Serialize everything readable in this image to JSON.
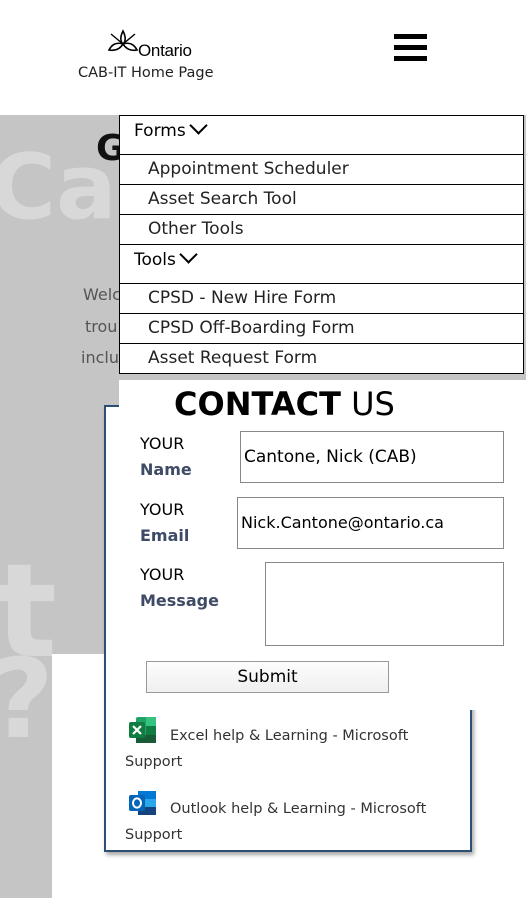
{
  "header": {
    "logo_text": "Ontario",
    "home_link": "CAB-IT Home Page",
    "menu_icon": "hamburger-menu-icon"
  },
  "background": {
    "title_fragment": "G",
    "para_lines": [
      "Welc",
      "trou",
      "inclu"
    ]
  },
  "menu": {
    "sections": [
      {
        "label": "Forms",
        "items": [
          "Appointment Scheduler",
          "Asset Search Tool",
          "Other Tools"
        ]
      },
      {
        "label": "Tools",
        "items": [
          "CPSD - New Hire Form",
          "CPSD Off-Boarding Form",
          "Asset Request Form"
        ]
      }
    ]
  },
  "contact": {
    "title_bold": "CONTACT",
    "title_rest": "US",
    "fields": {
      "name": {
        "prefix": "YOUR",
        "label": "Name",
        "value": "Cantone, Nick (CAB)"
      },
      "email": {
        "prefix": "YOUR",
        "label": "Email",
        "value": "Nick.Cantone@ontario.ca"
      },
      "message": {
        "prefix": "YOUR",
        "label": "Message",
        "value": ""
      }
    },
    "submit_label": "Submit"
  },
  "help_links": [
    {
      "icon": "excel-icon",
      "text_line1": "Excel help & Learning - Microsoft",
      "text_line2": "Support",
      "color": "#1d6f42"
    },
    {
      "icon": "outlook-icon",
      "text_line1": "Outlook help & Learning - Microsoft",
      "text_line2": "Support",
      "color": "#0364b8"
    }
  ],
  "colors": {
    "label_accent": "#3f4a66",
    "card_border": "#2c4f73"
  }
}
